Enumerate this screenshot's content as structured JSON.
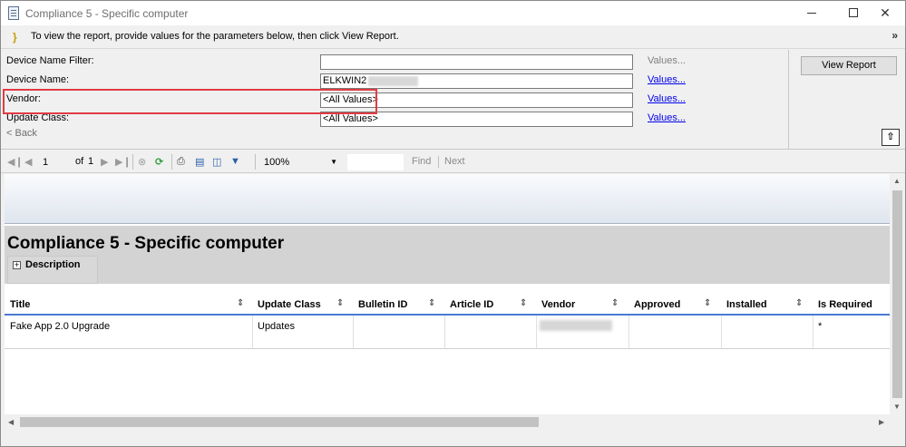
{
  "window": {
    "title": "Compliance 5 - Specific computer",
    "min_glyph": "—",
    "close_glyph": "✕"
  },
  "infobar": {
    "text": "To view the report, provide values for the parameters below, then click View Report."
  },
  "params": [
    {
      "label": "Device Name Filter:",
      "value": "",
      "link": "Values...",
      "link_enabled": false
    },
    {
      "label": "Device Name:",
      "value": "ELKWIN2",
      "link": "Values...",
      "link_enabled": true
    },
    {
      "label": "Vendor:",
      "value": "<All Values>",
      "link": "Values...",
      "link_enabled": true
    },
    {
      "label": "Update Class:",
      "value": "<All Values>",
      "link": "Values...",
      "link_enabled": true
    }
  ],
  "buttons": {
    "view_report": "View Report",
    "back": "< Back"
  },
  "toolbar": {
    "page": "1",
    "of_text": "of",
    "total_pages": "1",
    "zoom": "100%",
    "find": "Find",
    "next": "Next"
  },
  "report": {
    "title": "Compliance 5 - Specific computer",
    "description_label": "Description",
    "columns": [
      "Title",
      "Update Class",
      "Bulletin ID",
      "Article ID",
      "Vendor",
      "Approved",
      "Installed",
      "Is Required"
    ],
    "rows": [
      {
        "title": "Fake App 2.0 Upgrade",
        "update_class": "Updates",
        "bulletin_id": "",
        "article_id": "",
        "vendor": "",
        "approved": "",
        "installed": "",
        "is_required": "*"
      }
    ]
  },
  "colors": {
    "highlight": "#e03c45",
    "link": "#0000ee",
    "header_line": "#4a7bd3"
  }
}
